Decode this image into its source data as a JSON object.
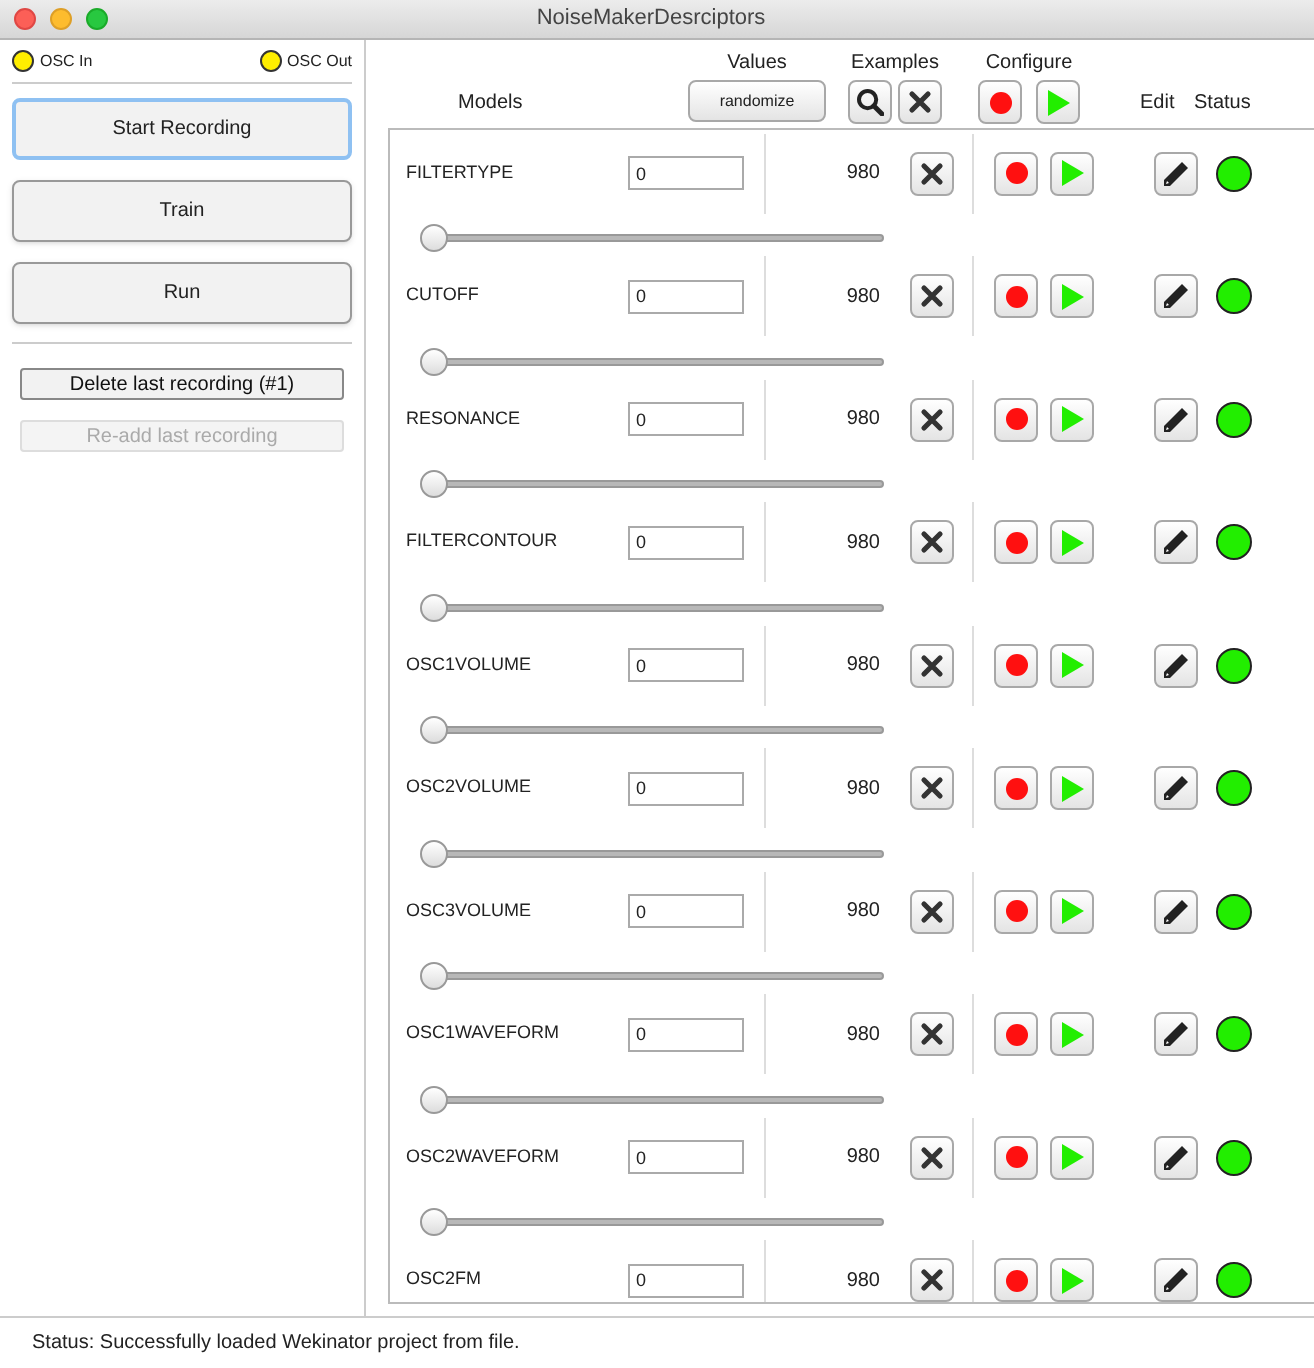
{
  "window": {
    "title": "NoiseMakerDesrciptors"
  },
  "osc": [
    {
      "label": "OSC In",
      "color": "#ffee00"
    },
    {
      "label": "OSC Out",
      "color": "#ffee00"
    }
  ],
  "actions": [
    {
      "label": "Start Recording",
      "focused": true
    },
    {
      "label": "Train",
      "focused": false
    },
    {
      "label": "Run",
      "focused": false
    }
  ],
  "recording_buttons": [
    {
      "label": "Delete last recording (#1)",
      "disabled": false
    },
    {
      "label": "Re-add last recording",
      "disabled": true
    }
  ],
  "header": {
    "models": "Models",
    "values": "Values",
    "randomize": "randomize",
    "examples": "Examples",
    "configure": "Configure",
    "edit": "Edit",
    "status": "Status"
  },
  "models": [
    {
      "name": "FILTERTYPE",
      "value": "0",
      "count": "980",
      "level": 0,
      "color": "#22ee00"
    },
    {
      "name": "CUTOFF",
      "value": "0",
      "count": "980",
      "level": 0,
      "color": "#22ee00"
    },
    {
      "name": "RESONANCE",
      "value": "0",
      "count": "980",
      "level": 0,
      "color": "#22ee00"
    },
    {
      "name": "FILTERCONTOUR",
      "value": "0",
      "count": "980",
      "level": 0,
      "color": "#22ee00"
    },
    {
      "name": "OSC1VOLUME",
      "value": "0",
      "count": "980",
      "level": 0,
      "color": "#22ee00"
    },
    {
      "name": "OSC2VOLUME",
      "value": "0",
      "count": "980",
      "level": 0,
      "color": "#22ee00"
    },
    {
      "name": "OSC3VOLUME",
      "value": "0",
      "count": "980",
      "level": 0,
      "color": "#22ee00"
    },
    {
      "name": "OSC1WAVEFORM",
      "value": "0",
      "count": "980",
      "level": 0,
      "color": "#22ee00"
    },
    {
      "name": "OSC2WAVEFORM",
      "value": "0",
      "count": "980",
      "level": 0,
      "color": "#22ee00"
    },
    {
      "name": "OSC2FM",
      "value": "0",
      "count": "980",
      "color": "#22ee00"
    }
  ],
  "status_bar": "Status:  Successfully loaded Wekinator project from file."
}
